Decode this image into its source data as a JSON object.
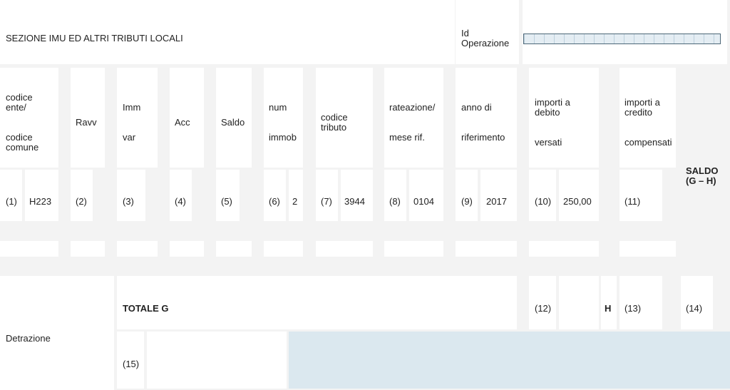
{
  "header": {
    "section_title": "SEZIONE IMU ED ALTRI TRIBUTI LOCALI",
    "id_label_1": "Id",
    "id_label_2": "Operazione"
  },
  "columns": {
    "codice_ente_1": "codice",
    "codice_ente_2": "ente/",
    "codice_comune_1": "codice",
    "codice_comune_2": "comune",
    "ravv": "Ravv",
    "imm": "Imm",
    "var": "var",
    "acc": "Acc",
    "saldo": "Saldo",
    "num": "num",
    "immob": "immob",
    "codice_tributo_1": "codice",
    "codice_tributo_2": "tributo",
    "rateazione": "rateazione/",
    "mese_rif": "mese rif.",
    "anno_di": "anno di",
    "riferimento": "riferimento",
    "importi_debito_1": "importi a",
    "importi_debito_2": "debito",
    "versati": "versati",
    "importi_credito_1": "importi a",
    "importi_credito_2": "credito",
    "compensati": "compensati",
    "saldo_gh_1": "SALDO",
    "saldo_gh_2": "(G – H)"
  },
  "row1": {
    "n1": "(1)",
    "codice_ente": "H223",
    "n2": "(2)",
    "n3": "(3)",
    "n4": "(4)",
    "n5": "(5)",
    "n6": "(6)",
    "num_immob": "2",
    "n7": "(7)",
    "codice_tributo": "3944",
    "n8": "(8)",
    "rateazione": "0104",
    "n9": "(9)",
    "anno": "2017",
    "n10": "(10)",
    "importo_debito": "250,00",
    "n11": "(11)"
  },
  "totals": {
    "totale_g": "TOTALE  G",
    "n12": "(12)",
    "h": "H",
    "n13": "(13)",
    "n14": "(14)",
    "detrazione": "Detrazione",
    "n15": "(15)"
  }
}
